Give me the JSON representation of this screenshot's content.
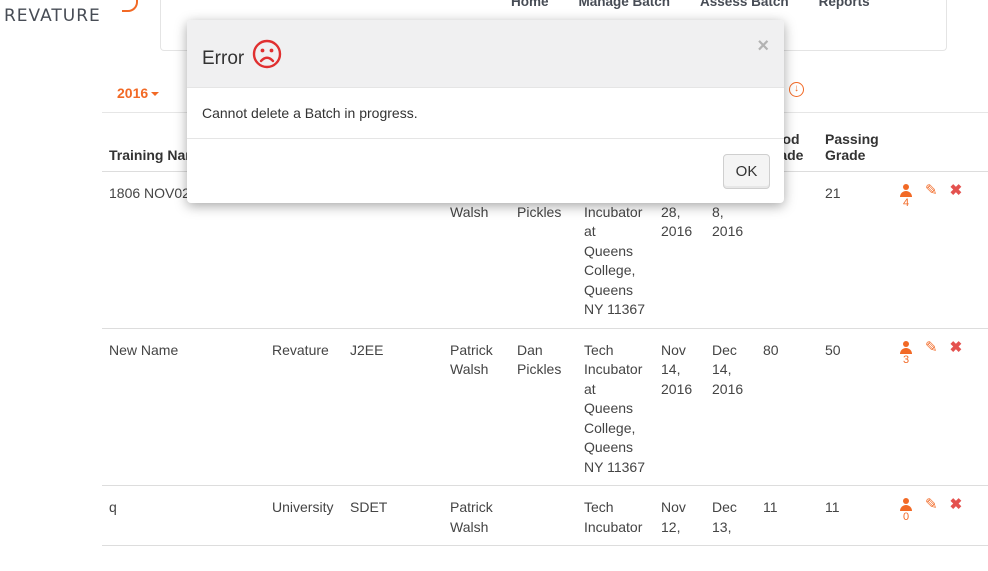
{
  "brand": {
    "logo_text": "REVATURE",
    "accent_color": "#f26925"
  },
  "nav": {
    "items": [
      "Home",
      "Manage Batch",
      "Assess Batch",
      "Reports"
    ]
  },
  "filter": {
    "year": "2016"
  },
  "table": {
    "headers": {
      "training_name": "Training Name",
      "good_grade": "Good Grade",
      "passing_grade": "Passing Grade"
    },
    "rows": [
      {
        "name": "1806 NOV02",
        "training_type": "",
        "skill": "",
        "trainer": "Walsh",
        "cotrainer": "Pickles",
        "location": "Incubator at Queens College, Queens NY 11367",
        "start": "28, 2016",
        "end": "8, 2016",
        "good": "",
        "passing": "21",
        "trainee_count": "4"
      },
      {
        "name": "New Name",
        "training_type": "Revature",
        "skill": "J2EE",
        "trainer": "Patrick Walsh",
        "cotrainer": "Dan Pickles",
        "location": "Tech Incubator at Queens College, Queens NY 11367",
        "start": "Nov 14, 2016",
        "end": "Dec 14, 2016",
        "good": "80",
        "passing": "50",
        "trainee_count": "3"
      },
      {
        "name": "q",
        "training_type": "University",
        "skill": "SDET",
        "trainer": "Patrick Walsh",
        "cotrainer": "",
        "location": "Tech Incubator",
        "start": "Nov 12,",
        "end": "Dec 13,",
        "good": "11",
        "passing": "11",
        "trainee_count": "0"
      }
    ]
  },
  "modal": {
    "title": "Error",
    "icon": "sad-face-icon",
    "message": "Cannot delete a Batch in progress.",
    "close_label": "×",
    "ok_label": "OK",
    "icon_color": "#e03030"
  }
}
